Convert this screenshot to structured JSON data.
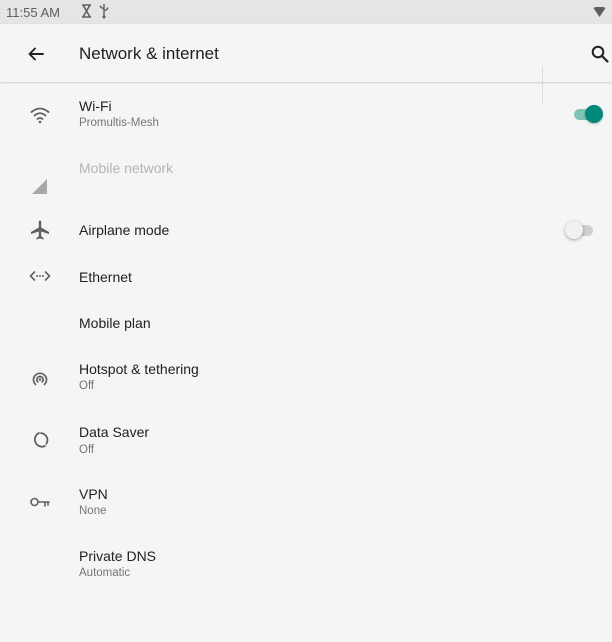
{
  "status_bar": {
    "time": "11:55 AM",
    "icons": [
      "hourglass-icon",
      "usb-icon",
      "signal-icon"
    ]
  },
  "app_bar": {
    "title": "Network & internet",
    "icons": [
      "back-arrow-icon",
      "search-icon"
    ]
  },
  "settings": [
    {
      "id": "wifi",
      "title": "Wi-Fi",
      "subtitle": "Promultis-Mesh",
      "icon": "wifi-icon",
      "toggle": true,
      "enabled": true
    },
    {
      "id": "mobile-network",
      "title": "Mobile network",
      "subtitle": "",
      "icon": "cellular-signal-icon",
      "enabled": false
    },
    {
      "id": "airplane-mode",
      "title": "Airplane mode",
      "subtitle": "",
      "icon": "airplane-icon",
      "toggle": false,
      "enabled": true
    },
    {
      "id": "ethernet",
      "title": "Ethernet",
      "subtitle": "",
      "icon": "ethernet-icon",
      "enabled": true
    },
    {
      "id": "mobile-plan",
      "title": "Mobile plan",
      "subtitle": "",
      "icon": "",
      "enabled": true
    },
    {
      "id": "hotspot",
      "title": "Hotspot & tethering",
      "subtitle": "Off",
      "icon": "hotspot-icon",
      "enabled": true
    },
    {
      "id": "data-saver",
      "title": "Data Saver",
      "subtitle": "Off",
      "icon": "data-saver-icon",
      "enabled": true
    },
    {
      "id": "vpn",
      "title": "VPN",
      "subtitle": "None",
      "icon": "vpn-key-icon",
      "enabled": true
    },
    {
      "id": "private-dns",
      "title": "Private DNS",
      "subtitle": "Automatic",
      "icon": "",
      "enabled": true
    }
  ],
  "colors": {
    "accent": "#00897b",
    "accent_track": "#7fc2b6",
    "background": "#f5f5f5",
    "status_bar": "#e5e5e5",
    "primary_text": "#212121",
    "secondary_text": "#757575",
    "disabled_text": "#b4b4b4"
  }
}
